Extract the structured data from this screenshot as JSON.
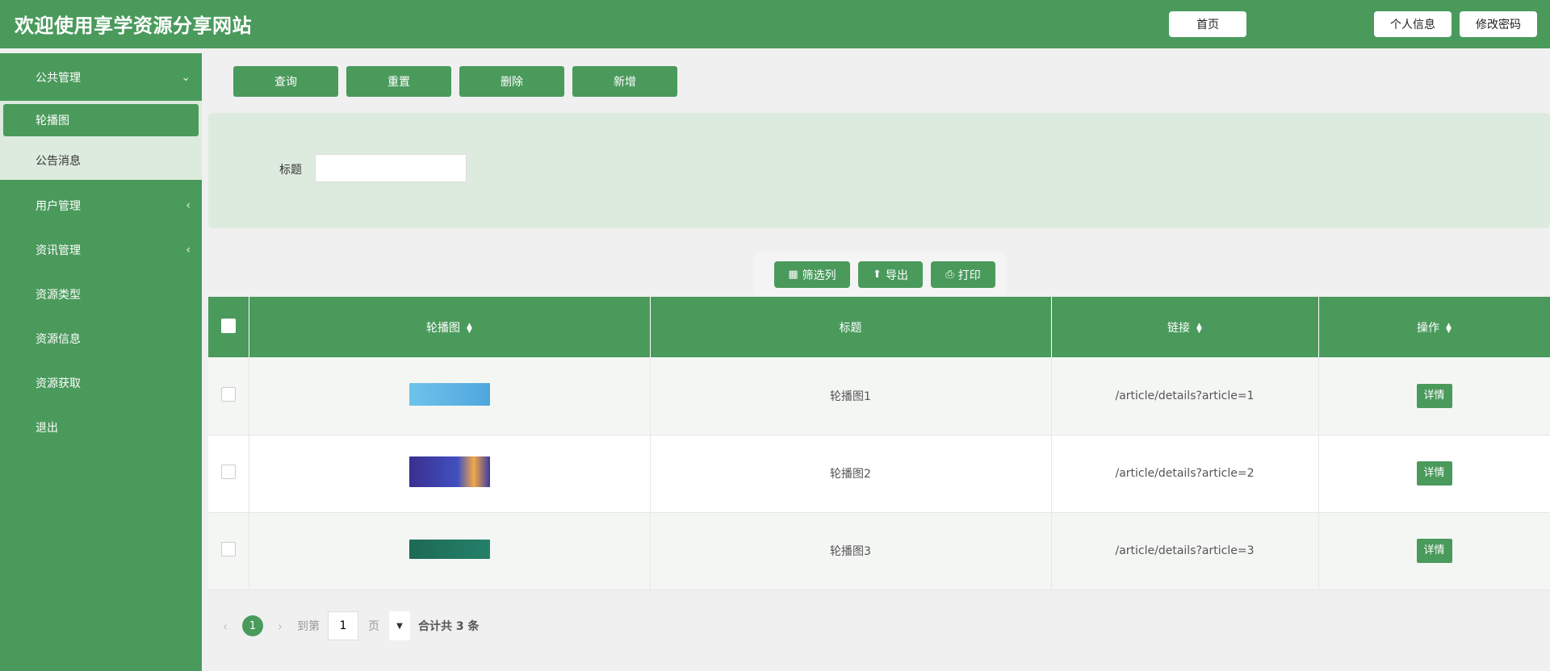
{
  "header": {
    "title": "欢迎使用享学资源分享网站",
    "home": "首页",
    "profile": "个人信息",
    "change_password": "修改密码"
  },
  "sidebar": {
    "groups": [
      {
        "label": "公共管理",
        "arrow": "⌄"
      },
      {
        "label": "用户管理",
        "arrow": "‹"
      },
      {
        "label": "资讯管理",
        "arrow": "‹"
      },
      {
        "label": "资源类型"
      },
      {
        "label": "资源信息"
      },
      {
        "label": "资源获取"
      },
      {
        "label": "退出"
      }
    ],
    "subitems": [
      {
        "label": "轮播图",
        "active": true
      },
      {
        "label": "公告消息"
      }
    ]
  },
  "toolbar": {
    "query": "查询",
    "reset": "重置",
    "delete": "删除",
    "add": "新增"
  },
  "search": {
    "title_label": "标题",
    "title_value": ""
  },
  "table_tools": {
    "filter": "筛选列",
    "export": "导出",
    "print": "打印"
  },
  "table": {
    "columns": [
      "轮播图",
      "标题",
      "链接",
      "操作"
    ],
    "rows": [
      {
        "title": "轮播图1",
        "link": "/article/details?article=1",
        "action": "详情",
        "thumb_color": "#4fb0e0"
      },
      {
        "title": "轮播图2",
        "link": "/article/details?article=2",
        "action": "详情",
        "thumb_color": "#3b3fa8"
      },
      {
        "title": "轮播图3",
        "link": "/article/details?article=3",
        "action": "详情",
        "thumb_color": "#1f6b57"
      }
    ]
  },
  "pagination": {
    "current_page": "1",
    "goto_label": "到第",
    "goto_value": "1",
    "page_label": "页",
    "total_text": "合计共 3 条"
  },
  "colors": {
    "accent": "#4a9a5c",
    "panel": "#dcebdd"
  }
}
